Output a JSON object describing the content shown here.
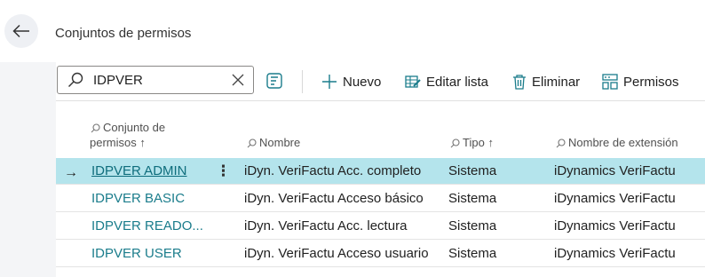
{
  "header": {
    "title": "Conjuntos de permisos"
  },
  "search": {
    "value": "IDPVER"
  },
  "toolbar": {
    "new_label": "Nuevo",
    "edit_list_label": "Editar lista",
    "delete_label": "Eliminar",
    "permissions_label": "Permisos"
  },
  "columns": {
    "code_line1": "Conjunto de",
    "code_line2": "permisos",
    "sort_arrow": "↑",
    "name": "Nombre",
    "type": "Tipo",
    "type_sort": "↑",
    "extension": "Nombre de extensión"
  },
  "rows": [
    {
      "code": "IDPVER ADMIN",
      "name": "iDyn. VeriFactu Acc. completo",
      "type": "Sistema",
      "extension": "iDynamics VeriFactu",
      "selected": true
    },
    {
      "code": "IDPVER BASIC",
      "name": "iDyn. VeriFactu Acceso básico",
      "type": "Sistema",
      "extension": "iDynamics VeriFactu",
      "selected": false
    },
    {
      "code": "IDPVER READO...",
      "name": "iDyn. VeriFactu Acc. lectura",
      "type": "Sistema",
      "extension": "iDynamics VeriFactu",
      "selected": false
    },
    {
      "code": "IDPVER USER",
      "name": "iDyn. VeriFactu Acceso usuario",
      "type": "Sistema",
      "extension": "iDynamics VeriFactu",
      "selected": false
    }
  ],
  "row_menu": "⋮",
  "row_arrow": "→",
  "colors": {
    "selected_row": "#b4e4ec",
    "link": "#1a7c8b",
    "accent": "#0e6d7c"
  }
}
